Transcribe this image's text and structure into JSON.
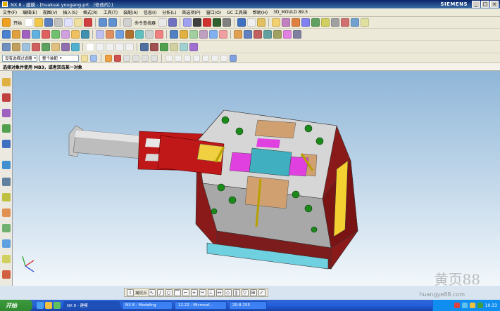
{
  "window": {
    "title": "NX 8 - 建模 - [huakuai yougang.prt （修改的）]",
    "brand": "SIEMENS",
    "buttons": [
      "_",
      "□",
      "×"
    ]
  },
  "menu": [
    "文件(F)",
    "编辑(E)",
    "视图(V)",
    "插入(S)",
    "格式(R)",
    "工具(T)",
    "装配(A)",
    "信息(I)",
    "分析(L)",
    "首选项(P)",
    "窗口(O)",
    "GC 工具箱",
    "帮助(H)",
    "3D_MOULD 89.5"
  ],
  "toolbar1": {
    "start_label": "开始",
    "command_finder": "命令查找器"
  },
  "selection": {
    "filter": "没有选择过滤器",
    "scope": "整个装配",
    "arrow": "▾"
  },
  "cue_line": "选择对象并使用 MB3，或者双击某一对象",
  "snap": {
    "label": "捕捉点"
  },
  "watermark": {
    "main": "黄页88",
    "sub": "huangye88.com"
  },
  "taskbar": {
    "start": "开始",
    "tasks": [
      "NX 8 - 建模",
      "NX 8 - Modeling",
      "12.22 - Microsof...",
      "20-8-255"
    ],
    "clock": "19:33"
  },
  "icons": {
    "start_button": "windows-start-icon",
    "viewport_triad": "wcs-triad-icon"
  }
}
